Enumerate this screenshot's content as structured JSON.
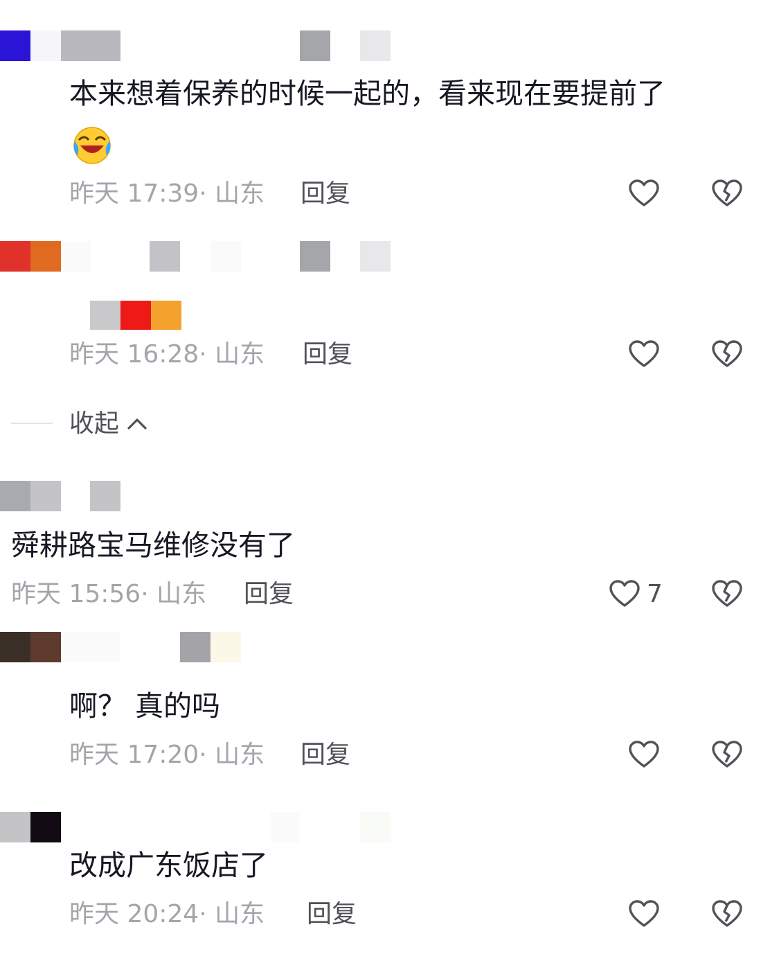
{
  "comments": [
    {
      "text": "本来想着保养的时候一起的，看来现在要提前了",
      "emoji": "laughing-tears-emoji",
      "time": "昨天 17:39",
      "location": "· 山东",
      "reply_label": "回复",
      "likes": ""
    },
    {
      "text": "",
      "time": "昨天 16:28",
      "location": "· 山东",
      "reply_label": "回复",
      "likes": ""
    },
    {
      "text": "舜耕路宝马维修没有了",
      "time": "昨天 15:56",
      "location": "· 山东",
      "reply_label": "回复",
      "likes": "7"
    },
    {
      "text": "啊？ 真的吗",
      "time": "昨天 17:20",
      "location": "· 山东",
      "reply_label": "回复",
      "likes": ""
    },
    {
      "text": "改成广东饭店了",
      "time": "昨天 20:24",
      "location": "· 山东",
      "reply_label": "回复",
      "likes": ""
    }
  ],
  "collapse_label": "收起",
  "colors": {
    "text": "#161823",
    "meta": "#a3a5ab",
    "reply": "#505258",
    "icon_stroke": "#505258"
  },
  "icons": {
    "like": "heart-outline-icon",
    "dislike": "broken-heart-icon",
    "collapse": "chevron-up-icon"
  }
}
